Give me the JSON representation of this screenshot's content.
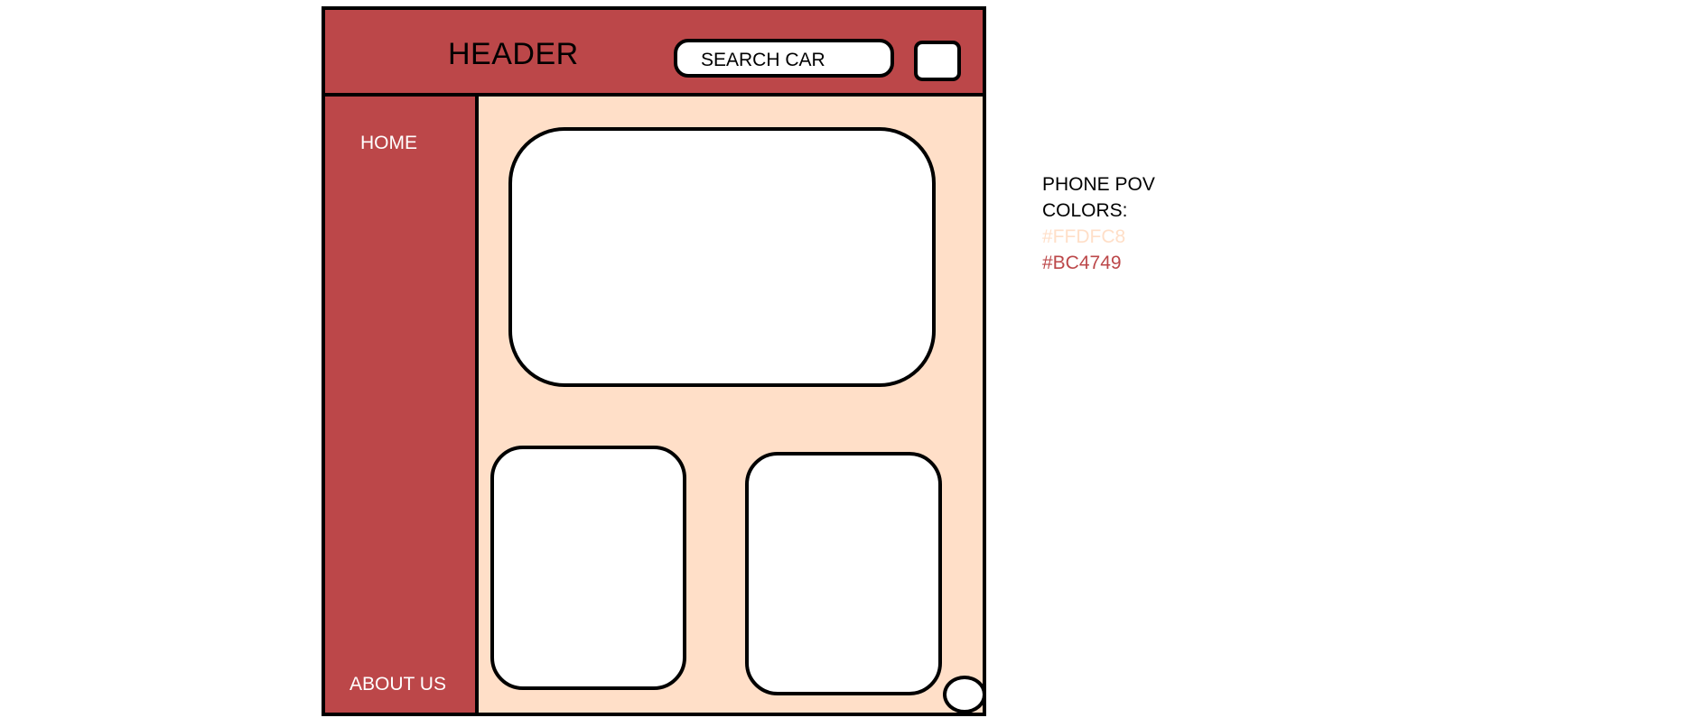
{
  "header": {
    "title": "HEADER",
    "search_label": "SEARCH CAR"
  },
  "sidebar": {
    "items": [
      {
        "label": "HOME"
      },
      {
        "label": "ABOUT US"
      }
    ]
  },
  "notes": {
    "title": "PHONE POV",
    "colors_label": "COLORS:",
    "colors": [
      "#FFDFC8",
      "#BC4749"
    ]
  }
}
